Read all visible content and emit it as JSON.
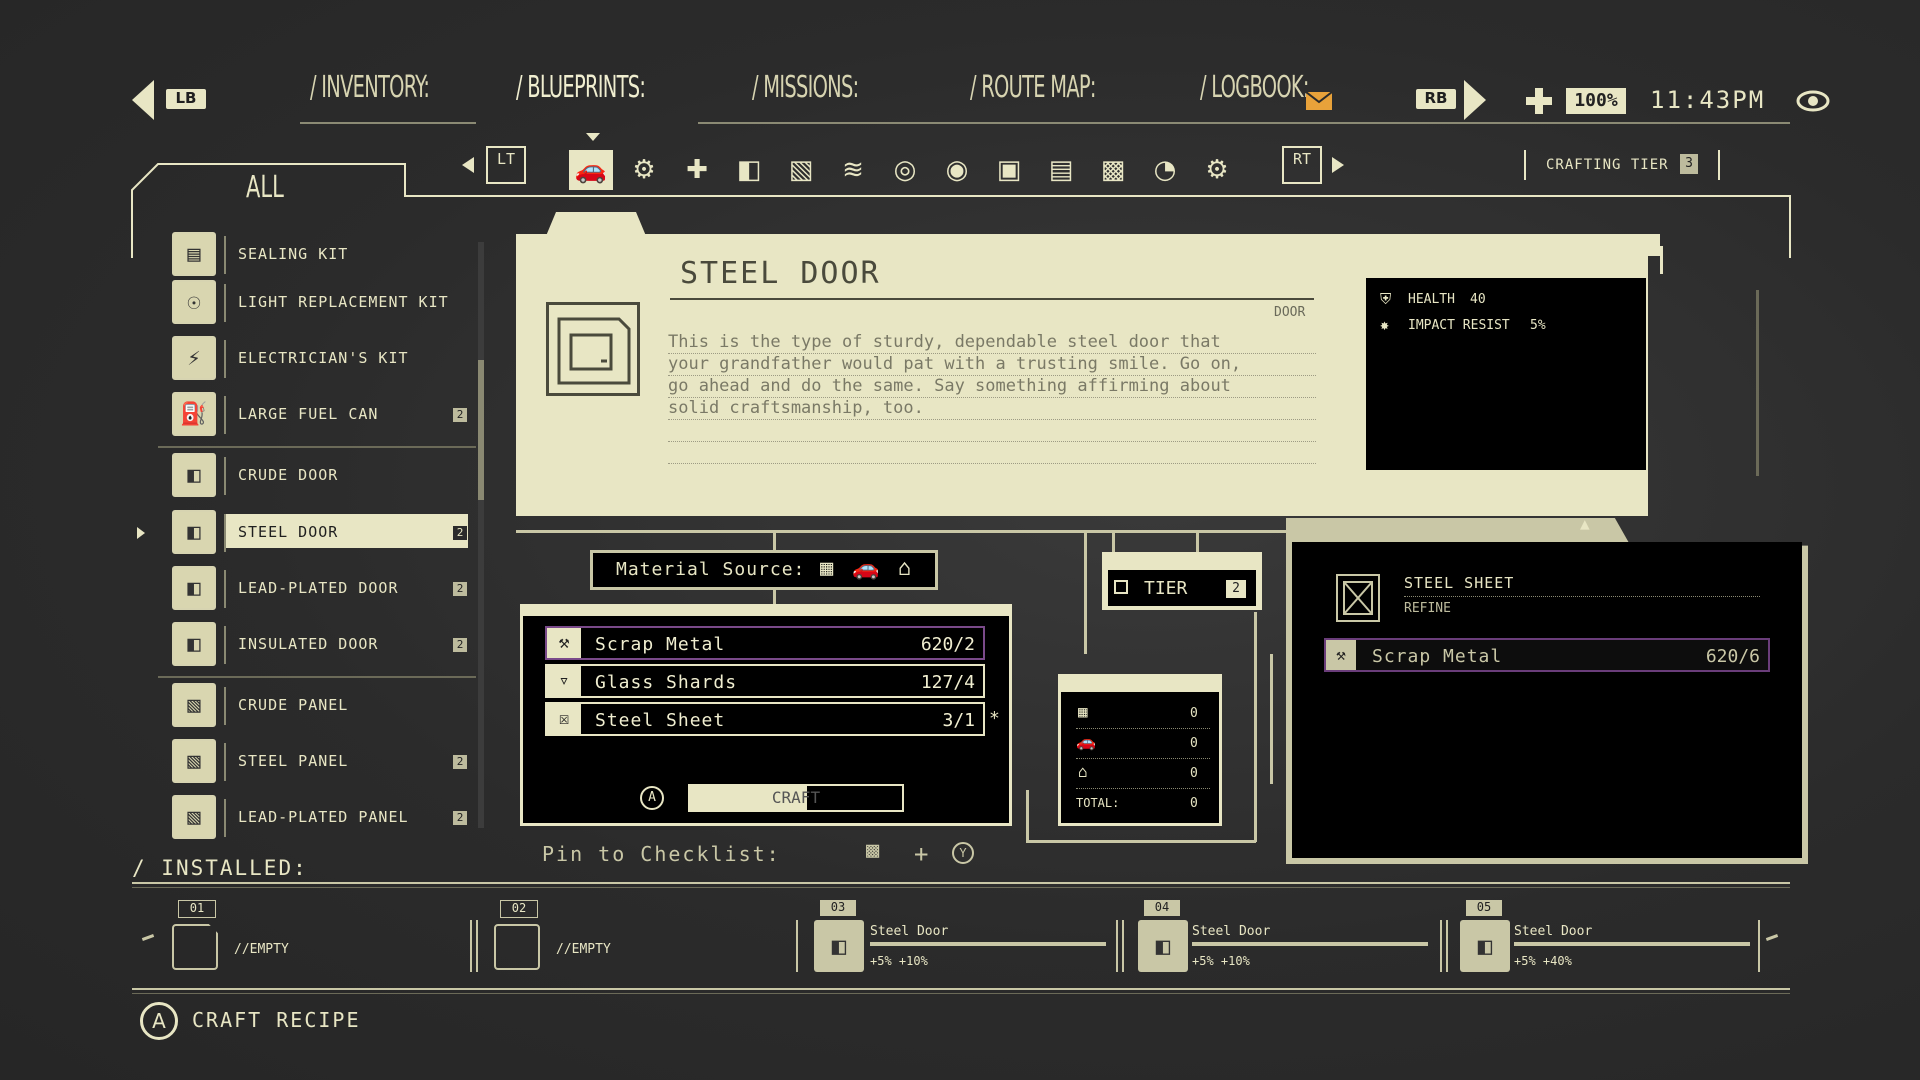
{
  "topbar": {
    "lb": "LB",
    "rb": "RB",
    "tabs": [
      "/ INVENTORY:",
      "/ BLUEPRINTS:",
      "/ MISSIONS:",
      "/ ROUTE MAP:",
      "/ LOGBOOK:"
    ],
    "zoom": "100%",
    "time": "11:43PM"
  },
  "categories": {
    "lt": "LT",
    "rt": "RT",
    "crafting_tier_label": "CRAFTING TIER",
    "crafting_tier_value": "3",
    "filter_label": "ALL"
  },
  "list": [
    {
      "label": "SEALING KIT",
      "badge": ""
    },
    {
      "label": "LIGHT REPLACEMENT KIT",
      "badge": ""
    },
    {
      "label": "ELECTRICIAN'S KIT",
      "badge": ""
    },
    {
      "label": "LARGE FUEL CAN",
      "badge": "2"
    },
    {
      "label": "CRUDE DOOR",
      "badge": ""
    },
    {
      "label": "STEEL DOOR",
      "badge": "2"
    },
    {
      "label": "LEAD-PLATED DOOR",
      "badge": "2"
    },
    {
      "label": "INSULATED DOOR",
      "badge": "2"
    },
    {
      "label": "CRUDE PANEL",
      "badge": ""
    },
    {
      "label": "STEEL PANEL",
      "badge": "2"
    },
    {
      "label": "LEAD-PLATED PANEL",
      "badge": "2"
    }
  ],
  "detail": {
    "title": "STEEL DOOR",
    "type": "DOOR",
    "description_lines": [
      "This is the type of sturdy, dependable steel door that",
      "your grandfather would pat with a trusting smile. Go on,",
      "go ahead and do the same. Say something affirming about",
      "solid craftsmanship, too."
    ],
    "stats": {
      "health_label": "HEALTH",
      "health_value": "40",
      "impact_label": "IMPACT RESIST",
      "impact_value": "5%"
    }
  },
  "material_source_label": "Material Source:",
  "materials": [
    {
      "name": "Scrap Metal",
      "count": "620/2"
    },
    {
      "name": "Glass Shards",
      "count": "127/4"
    },
    {
      "name": "Steel Sheet",
      "count": "3/1"
    }
  ],
  "craft_button": "CRAFT",
  "craft_fill": 0.55,
  "tier": {
    "label": "TIER",
    "value": "2"
  },
  "totals": {
    "rows": [
      "0",
      "0",
      "0"
    ],
    "total_label": "TOTAL:",
    "total_value": "0"
  },
  "pin_label": "Pin to Checklist:",
  "sub_recipe": {
    "name": "STEEL SHEET",
    "action": "REFINE",
    "material": "Scrap Metal",
    "count": "620/6"
  },
  "installed": {
    "label": "INSTALLED:",
    "slots": [
      {
        "num": "01",
        "name": "//EMPTY",
        "stats": ""
      },
      {
        "num": "02",
        "name": "//EMPTY",
        "stats": ""
      },
      {
        "num": "03",
        "name": "Steel Door",
        "stats": "+5%  +10%"
      },
      {
        "num": "04",
        "name": "Steel Door",
        "stats": "+5%  +10%"
      },
      {
        "num": "05",
        "name": "Steel Door",
        "stats": "+5%  +40%"
      }
    ]
  },
  "footer": {
    "action": "CRAFT RECIPE",
    "button": "A"
  },
  "colors": {
    "cream": "#e8e6c4",
    "background": "#2b2b2b",
    "highlight": "#6a3d7a"
  }
}
